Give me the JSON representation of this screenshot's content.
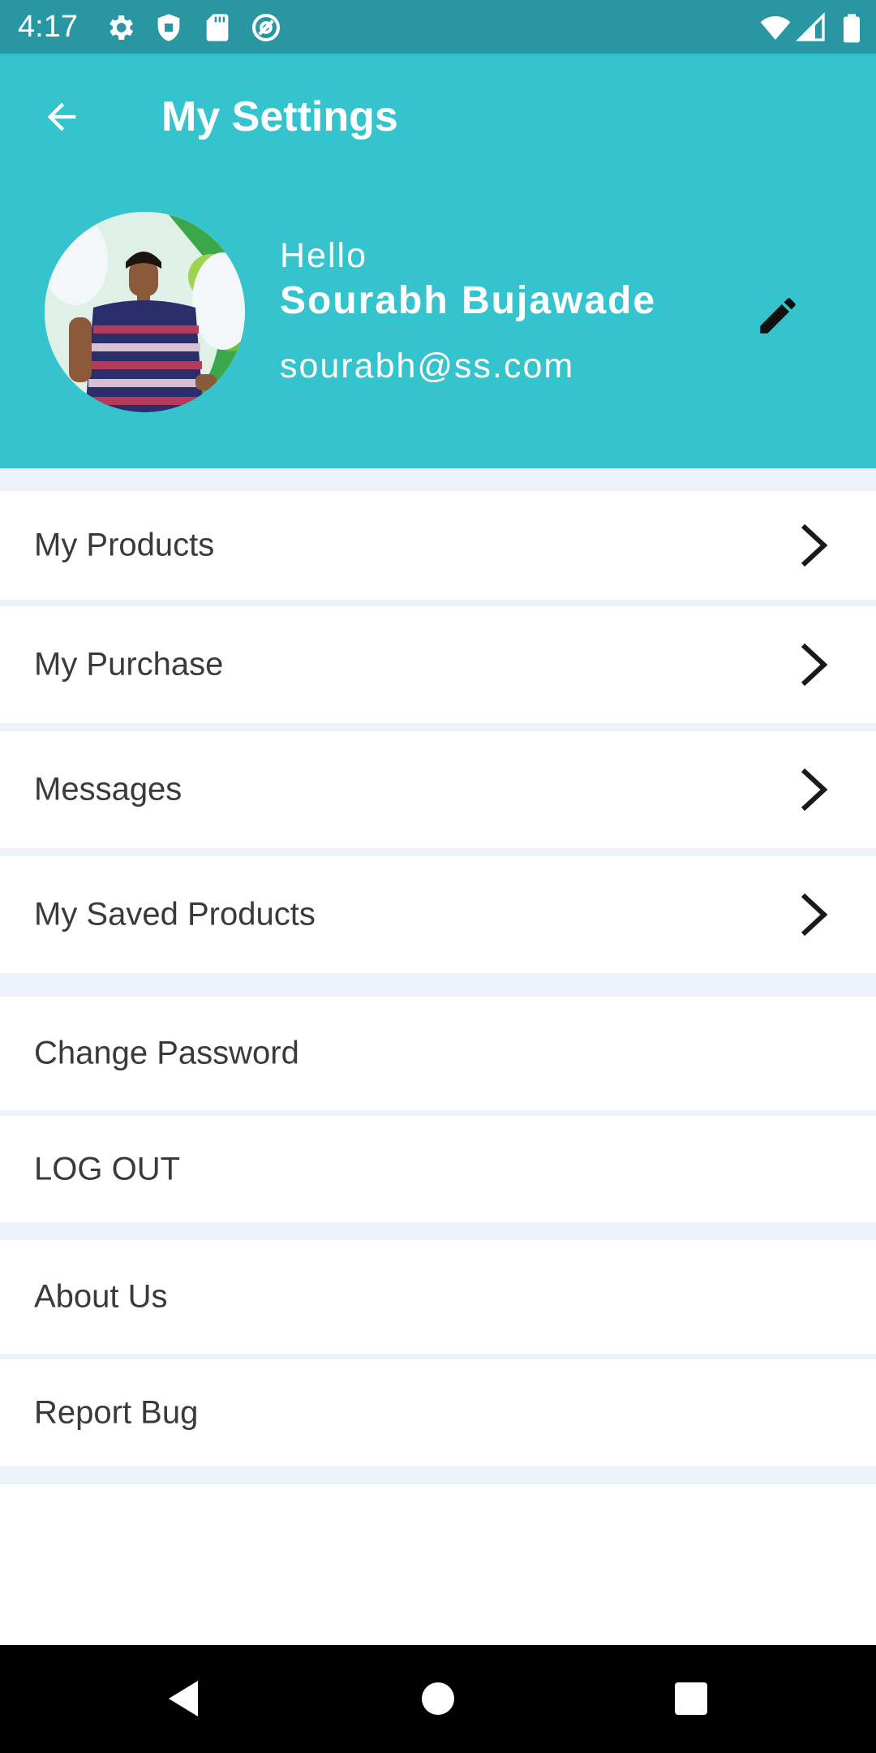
{
  "status_bar": {
    "time": "4:17",
    "left_icons": [
      "gear-icon",
      "shield-icon",
      "sd-card-icon",
      "at-sign-icon"
    ],
    "right_icons": [
      "wifi-icon",
      "signal-icon",
      "battery-icon"
    ]
  },
  "header": {
    "title": "My Settings",
    "back_icon": "arrow-left-icon",
    "background": "#35c4cd"
  },
  "profile": {
    "greeting": "Hello",
    "name": "Sourabh Bujawade",
    "email": "sourabh@ss.com",
    "edit_icon": "pencil-icon"
  },
  "menu": {
    "items": [
      {
        "label": "My Products",
        "icon": "chevron-right-icon"
      },
      {
        "label": "My Purchase",
        "icon": "chevron-right-icon"
      },
      {
        "label": "Messages",
        "icon": "chevron-right-icon"
      },
      {
        "label": "My Saved Products",
        "icon": "chevron-right-icon"
      },
      {
        "label": "Change Password"
      },
      {
        "label": "LOG OUT"
      },
      {
        "label": "About Us"
      },
      {
        "label": "Report Bug"
      }
    ]
  },
  "nav_bar": {
    "icons": [
      "back-triangle-icon",
      "home-circle-icon",
      "recents-square-icon"
    ]
  }
}
